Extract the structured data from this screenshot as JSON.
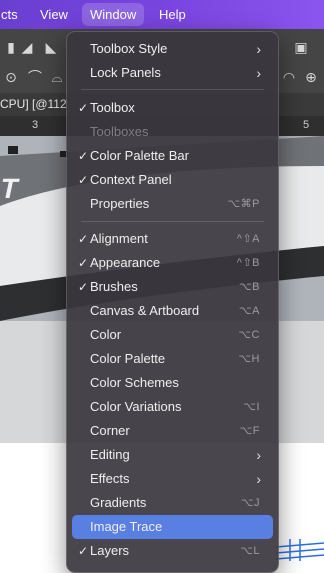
{
  "menubar": {
    "items": [
      "cts",
      "View",
      "Window",
      "Help"
    ]
  },
  "document": {
    "tab_title": "CPU] [@112",
    "ruler_left": "3",
    "ruler_right": "5"
  },
  "window_menu": {
    "items": [
      {
        "label": "Toolbox Style",
        "submenu": true,
        "checked": false,
        "shortcut": "",
        "disabled": false
      },
      {
        "label": "Lock Panels",
        "submenu": true,
        "checked": false,
        "shortcut": "",
        "disabled": false
      },
      {
        "label": "Toolbox",
        "submenu": false,
        "checked": true,
        "shortcut": "",
        "disabled": false
      },
      {
        "label": "Toolboxes",
        "submenu": false,
        "checked": false,
        "shortcut": "",
        "disabled": true
      },
      {
        "label": "Color Palette Bar",
        "submenu": false,
        "checked": true,
        "shortcut": "",
        "disabled": false
      },
      {
        "label": "Context Panel",
        "submenu": false,
        "checked": true,
        "shortcut": "",
        "disabled": false
      },
      {
        "label": "Properties",
        "submenu": false,
        "checked": false,
        "shortcut": "⌥⌘P",
        "disabled": false
      },
      {
        "label": "Alignment",
        "submenu": false,
        "checked": true,
        "shortcut": "^⇧A",
        "disabled": false
      },
      {
        "label": "Appearance",
        "submenu": false,
        "checked": true,
        "shortcut": "^⇧B",
        "disabled": false
      },
      {
        "label": "Brushes",
        "submenu": false,
        "checked": true,
        "shortcut": "⌥B",
        "disabled": false
      },
      {
        "label": "Canvas & Artboard",
        "submenu": false,
        "checked": false,
        "shortcut": "⌥A",
        "disabled": false
      },
      {
        "label": "Color",
        "submenu": false,
        "checked": false,
        "shortcut": "⌥C",
        "disabled": false
      },
      {
        "label": "Color Palette",
        "submenu": false,
        "checked": false,
        "shortcut": "⌥H",
        "disabled": false
      },
      {
        "label": "Color Schemes",
        "submenu": false,
        "checked": false,
        "shortcut": "",
        "disabled": false
      },
      {
        "label": "Color Variations",
        "submenu": false,
        "checked": false,
        "shortcut": "⌥I",
        "disabled": false
      },
      {
        "label": "Corner",
        "submenu": false,
        "checked": false,
        "shortcut": "⌥F",
        "disabled": false
      },
      {
        "label": "Editing",
        "submenu": true,
        "checked": false,
        "shortcut": "",
        "disabled": false
      },
      {
        "label": "Effects",
        "submenu": true,
        "checked": false,
        "shortcut": "",
        "disabled": false
      },
      {
        "label": "Gradients",
        "submenu": false,
        "checked": false,
        "shortcut": "⌥J",
        "disabled": false
      },
      {
        "label": "Image Trace",
        "submenu": false,
        "checked": false,
        "shortcut": "",
        "disabled": false,
        "highlighted": true
      },
      {
        "label": "Layers",
        "submenu": false,
        "checked": true,
        "shortcut": "⌥L",
        "disabled": false
      }
    ],
    "check_glyph": "✓",
    "arrow_glyph": "›"
  },
  "colors": {
    "menubar_accent": "#7a45e0",
    "highlight": "#5a7fe2"
  }
}
